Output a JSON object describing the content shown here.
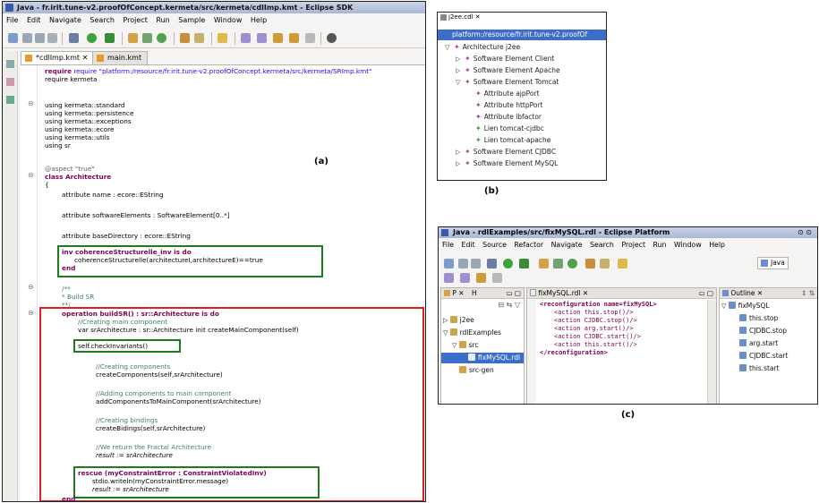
{
  "panel_a": {
    "window_title": "Java - fr.irit.tune-v2.proofOfConcept.kermeta/src/kermeta/cdlImp.kmt - Eclipse SDK",
    "menu": [
      "File",
      "Edit",
      "Navigate",
      "Search",
      "Project",
      "Run",
      "Sample",
      "Window",
      "Help"
    ],
    "tabs": [
      "*cdlImp.kmt",
      "main.kmt"
    ],
    "label": "(a)",
    "code": {
      "l1": "require \"platform:/resource/fr.irit.tune-v2.proofOfConcept.kermeta/src/kermeta/SRImp.kmt\"",
      "l2": "require kermeta",
      "l3": "using kermeta::standard",
      "l4": "using kermeta::persistence",
      "l5": "using kermeta::exceptions",
      "l6": "using kermeta::ecore",
      "l7": "using kermeta::utils",
      "l8": "using sr",
      "l9": "@aspect \"true\"",
      "l10": "class Architecture",
      "l11": "{",
      "l12": "attribute name : ecore::EString",
      "l13": "attribute softwareElements : SoftwareElement[0..*]",
      "l14": "attribute baseDirectory : ecore::EString",
      "l15a": "inv coherenceStructurelle_inv is do",
      "l15b": "coherenceStructurelle(architectureI,architectureE)==true",
      "l15c": "end",
      "l16a": "/**",
      "l16b": "* Build SR",
      "l16c": "**/",
      "l17": "operation buildSR() : sr::Architecture is do",
      "l18": "//Creating main component",
      "l19": "var srArchitecture : sr::Architecture init createMainComponent(self)",
      "l20": "self.checkInvariants()",
      "l21": "//Creating components",
      "l22": "createComponents(self,srArchitecture)",
      "l23": "//Adding components to main component",
      "l24": "addComponentsToMainComponent(srArchitecture)",
      "l25": "//Creating bindings",
      "l26": "createBidings(self,srArchitecture)",
      "l27": "//We return the Fractal Architecture",
      "l28": "result := srArchitecture",
      "l29": "rescue (myConstraintError : ConstraintViolatedInv)",
      "l30": "stdio.writeln(myConstraintError.message)",
      "l31": "result := srArchitecture",
      "l32": "end"
    }
  },
  "panel_b": {
    "tab": "j2ee.cdl",
    "root": "platform:/resource/fr.irit.tune-v2.proofOf",
    "items": [
      "Architecture j2ee",
      "Software Element Client",
      "Software Element Apache",
      "Software Element Tomcat",
      "Attribute ajpPort",
      "Attribute httpPort",
      "Attribute lbfactor",
      "Lien tomcat-cjdbc",
      "Lien tomcat-apache",
      "Software Element CJDBC",
      "Software Element MySQL"
    ],
    "label": "(b)"
  },
  "panel_c": {
    "window_title": "Java - rdlExamples/src/fixMySQL.rdl - Eclipse Platform",
    "menu": [
      "File",
      "Edit",
      "Source",
      "Refactor",
      "Navigate",
      "Search",
      "Project",
      "Run",
      "Window",
      "Help"
    ],
    "perspective": "Java",
    "explorer_tabs": [
      "P",
      "H"
    ],
    "explorer_items": [
      "j2ee",
      "rdlExamples",
      "src",
      "fixMySQL.rdl",
      "src-gen"
    ],
    "editor_tab": "fixMySQL.rdl",
    "code": [
      "<reconfiguration name=fixMySQL>",
      "<action this.stop()/>",
      "<action CJDBC.stop()/>",
      "<action arg.start()/>",
      "<action CJDBC.start()/>",
      "<action this.start()/>",
      "</reconfiguration>"
    ],
    "outline_tab": "Outline",
    "outline_items": [
      "fixMySQL",
      "this.stop",
      "CJDBC.stop",
      "arg.start",
      "CJDBC.start",
      "this.start"
    ],
    "label": "(c)"
  },
  "colors": {
    "green_box": "#1c7c1c",
    "red_box": "#e02020",
    "selection": "#3c6ec9"
  }
}
